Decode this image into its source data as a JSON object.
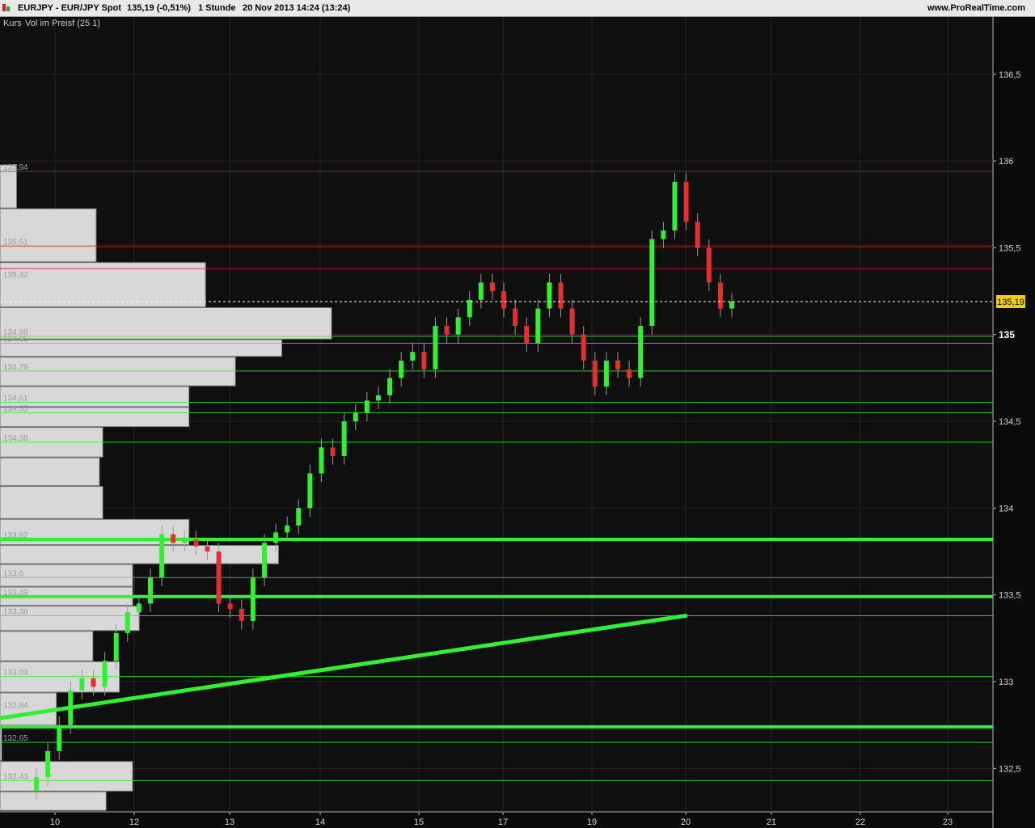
{
  "header": {
    "symbol": "EURJPY - EUR/JPY Spot",
    "price_change": "135,19 (-0,51%)",
    "period": "1 Stunde",
    "datetime": "20 Nov 2013 14:24 (13:24)",
    "site": "www.ProRealTime.com"
  },
  "panel": {
    "label": "Kurs",
    "indicator": "Vol im Preisf (25 1)"
  },
  "colors": {
    "background": "#0f0f0f",
    "up_candle": "#33ee33",
    "down_candle": "#e03030",
    "support_line": "#33ee33",
    "resistance_line": "#cc2222",
    "volume_bar": "#d8d8d8",
    "price_tag": "#f2d000"
  },
  "chart_data": {
    "type": "candlestick",
    "interval": "1 hour",
    "symbol": "EURJPY",
    "x_ticks": [
      "10",
      "12",
      "13",
      "14",
      "15",
      "17",
      "19",
      "20",
      "21",
      "22",
      "23"
    ],
    "y_ticks": [
      "132,5",
      "133",
      "133,5",
      "134",
      "134,5",
      "135",
      "135,5",
      "136",
      "136,5"
    ],
    "y_range": [
      132.25,
      136.83
    ],
    "last_price": "135,19",
    "last_price_value": 135.19,
    "closes": [
      132.45,
      132.6,
      132.75,
      132.95,
      133.02,
      132.97,
      133.12,
      133.28,
      133.4,
      133.45,
      133.6,
      133.85,
      133.8,
      133.82,
      133.78,
      133.75,
      133.45,
      133.42,
      133.35,
      133.6,
      133.8,
      133.86,
      133.9,
      134.0,
      134.2,
      134.35,
      134.3,
      134.5,
      134.55,
      134.62,
      134.65,
      134.75,
      134.85,
      134.9,
      134.8,
      135.05,
      135.0,
      135.1,
      135.2,
      135.3,
      135.25,
      135.15,
      135.05,
      134.95,
      135.15,
      135.3,
      135.15,
      135.0,
      134.85,
      134.7,
      134.85,
      134.8,
      134.75,
      135.05,
      135.55,
      135.6,
      135.88,
      135.65,
      135.5,
      135.3,
      135.15,
      135.19
    ],
    "ylim": [
      132.25,
      136.83
    ],
    "volume_profile": [
      {
        "label": "135,94",
        "price": 135.94,
        "volume": 0.05
      },
      {
        "label": "135,51",
        "price": 135.51,
        "volume": 0.29
      },
      {
        "label": "135,32",
        "price": 135.32,
        "volume": 0.62
      },
      {
        "label": "134,99",
        "price": 134.99,
        "volume": 1.0
      },
      {
        "label": "134,95",
        "price": 134.95,
        "volume": 0.85
      },
      {
        "label": "134,79",
        "price": 134.79,
        "volume": 0.71
      },
      {
        "label": "134,61",
        "price": 134.61,
        "volume": 0.57
      },
      {
        "label": "134,55",
        "price": 134.55,
        "volume": 0.57
      },
      {
        "label": "134,38",
        "price": 134.38,
        "volume": 0.31
      },
      {
        "label": "",
        "price": 134.2,
        "volume": 0.3
      },
      {
        "label": "",
        "price": 134.05,
        "volume": 0.31
      },
      {
        "label": "133,82",
        "price": 133.82,
        "volume": 0.57
      },
      {
        "label": "",
        "price": 133.75,
        "volume": 0.84
      },
      {
        "label": "133,6",
        "price": 133.6,
        "volume": 0.4
      },
      {
        "label": "133,49",
        "price": 133.49,
        "volume": 0.4
      },
      {
        "label": "133,38",
        "price": 133.38,
        "volume": 0.42
      },
      {
        "label": "",
        "price": 133.2,
        "volume": 0.28
      },
      {
        "label": "133,03",
        "price": 133.03,
        "volume": 0.36
      },
      {
        "label": "132,84",
        "price": 132.84,
        "volume": 0.17
      },
      {
        "label": "132,65",
        "price": 132.65,
        "volume": 0.0
      },
      {
        "label": "132,43",
        "price": 132.43,
        "volume": 0.4
      },
      {
        "label": "",
        "price": 132.3,
        "volume": 0.32
      }
    ],
    "horizontal_lines": [
      {
        "price": 135.94,
        "color": "red"
      },
      {
        "price": 135.51,
        "color": "red"
      },
      {
        "price": 135.38,
        "color": "red"
      },
      {
        "price": 134.99,
        "color": "green"
      },
      {
        "price": 134.95,
        "color": "green"
      },
      {
        "price": 134.79,
        "color": "green"
      },
      {
        "price": 134.61,
        "color": "green"
      },
      {
        "price": 134.55,
        "color": "green"
      },
      {
        "price": 134.38,
        "color": "green"
      },
      {
        "price": 133.82,
        "color": "green",
        "thick": true
      },
      {
        "price": 133.6,
        "color": "green"
      },
      {
        "price": 133.49,
        "color": "green",
        "thick": true
      },
      {
        "price": 133.38,
        "color": "green"
      },
      {
        "price": 133.03,
        "color": "green"
      },
      {
        "price": 132.74,
        "color": "green",
        "thick": true
      },
      {
        "price": 132.65,
        "color": "green"
      },
      {
        "price": 132.43,
        "color": "green"
      }
    ],
    "trendline": {
      "from": {
        "x": "10",
        "price": 132.79
      },
      "to": {
        "x": "20",
        "price": 133.38
      }
    }
  }
}
